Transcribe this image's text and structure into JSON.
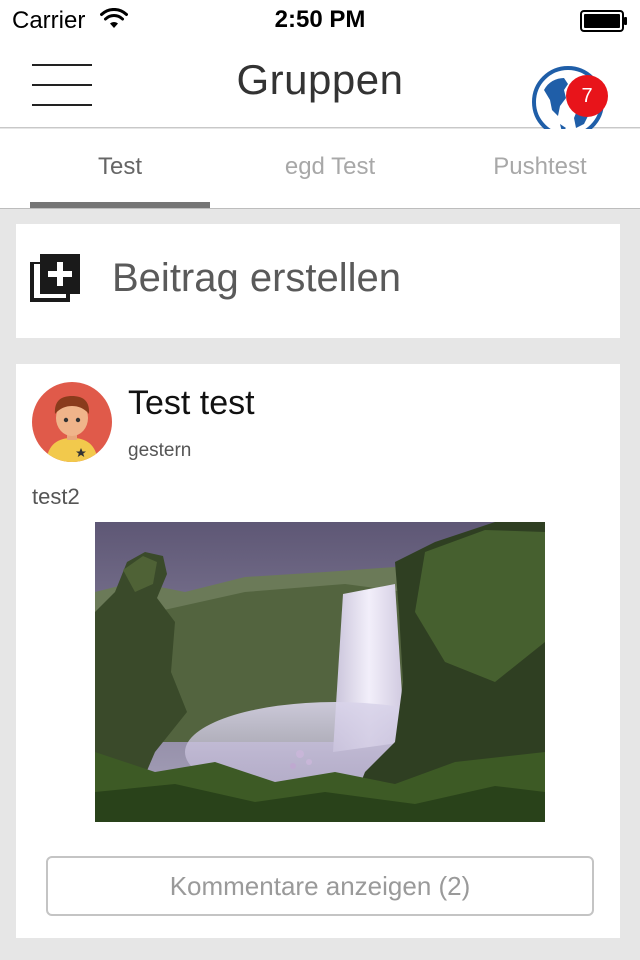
{
  "status_bar": {
    "carrier": "Carrier",
    "time": "2:50 PM"
  },
  "nav": {
    "title": "Gruppen",
    "notification_count": "7",
    "icons": [
      "menu-icon",
      "globe-icon"
    ]
  },
  "tabs": [
    {
      "label": "Test",
      "active": true
    },
    {
      "label": "egd Test",
      "active": false
    },
    {
      "label": "Pushtest",
      "active": false
    }
  ],
  "create_post": {
    "label": "Beitrag erstellen",
    "icon": "add-post-icon"
  },
  "post": {
    "author": "Test test",
    "time": "gestern",
    "text": "test2",
    "comments_label": "Kommentare anzeigen (2)"
  },
  "colors": {
    "badge": "#e8141a",
    "globe": "#1f5ea8",
    "avatar_bg": "#e05a4a",
    "background": "#e6e6e6"
  }
}
